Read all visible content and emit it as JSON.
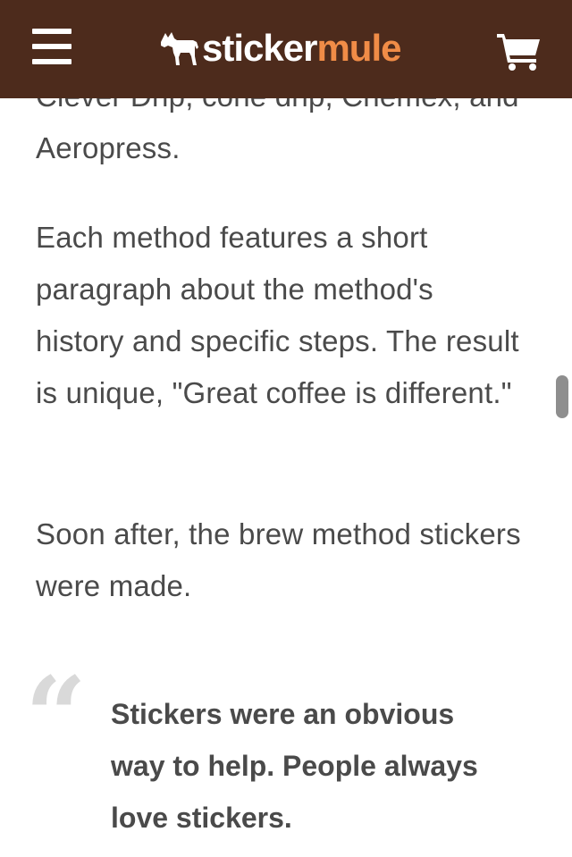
{
  "header": {
    "logo_text_primary": "sticker",
    "logo_text_accent": "mule",
    "menu_icon": "hamburger-menu-icon",
    "cart_icon": "shopping-cart-icon",
    "background_color": "#4d2b1c",
    "accent_color": "#f08c47"
  },
  "article": {
    "paragraphs": [
      "Clever Drip, cone drip, Chemex, and Aeropress.",
      "Each method features a short paragraph about the method's history and specific steps. The result is unique, \"Great coffee is different.\"",
      "Soon after, the brew method stickers were made."
    ],
    "quote_mark": "“",
    "quote_text": "Stickers were an obvious way to help. People always love stickers."
  }
}
